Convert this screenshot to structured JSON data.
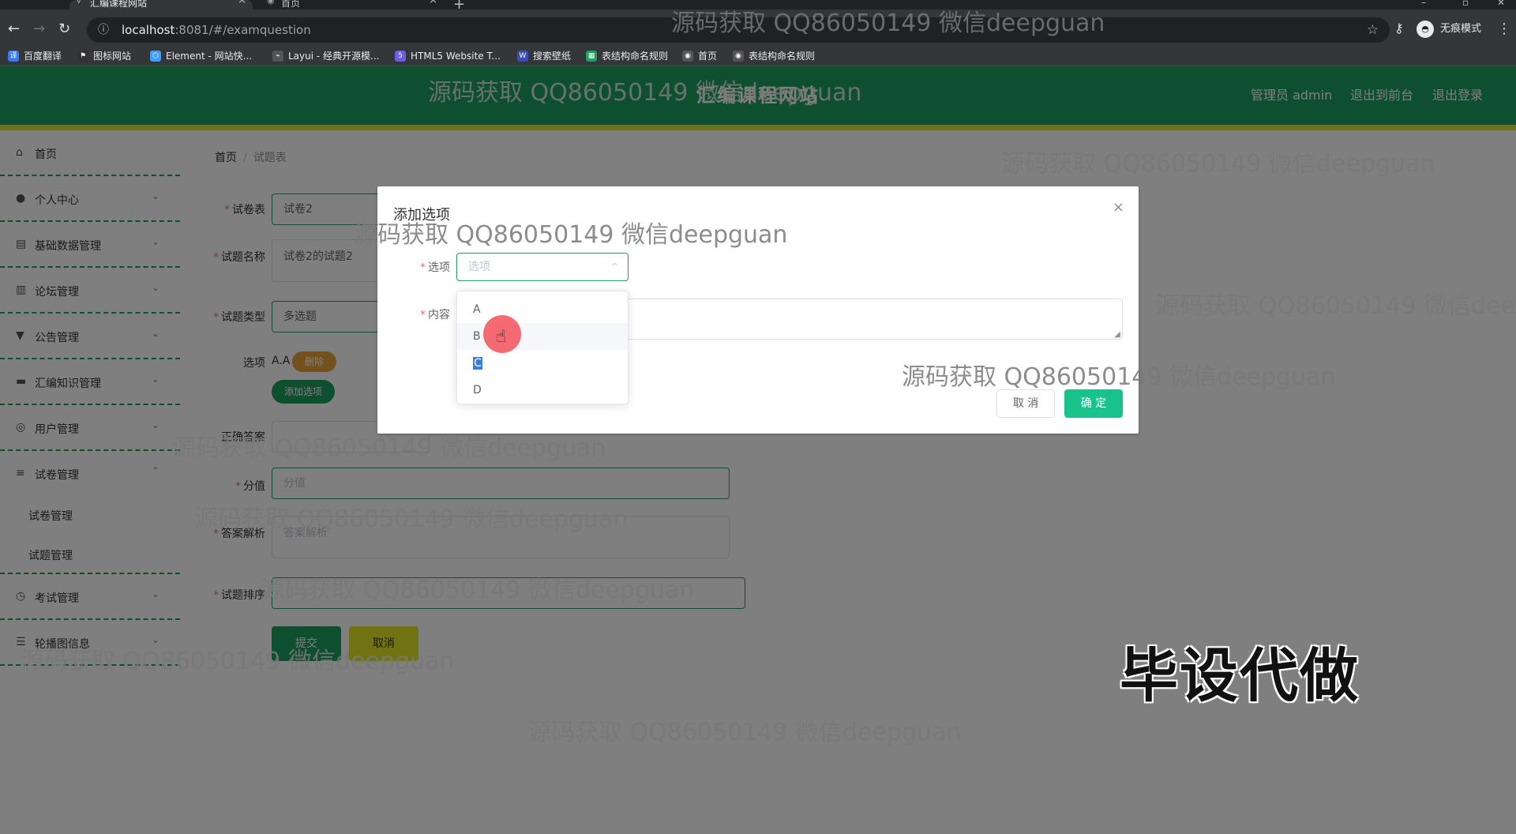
{
  "browser": {
    "tabs": [
      {
        "title": "汇编课程网站",
        "active": true
      },
      {
        "title": "首页",
        "active": false
      }
    ],
    "url_host": "localhost",
    "url_path": ":8081/#/examquestion",
    "profile_label": "无痕模式",
    "bookmarks": [
      "百度翻译",
      "图标网站",
      "Element - 网站快...",
      "Layui - 经典开源模...",
      "HTML5 Website T...",
      "搜索壁纸",
      "表结构命名规则",
      "首页",
      "表结构命名规则"
    ]
  },
  "header": {
    "site_title": "汇编课程网站",
    "user_label": "管理员 admin",
    "back_link": "退出到前台",
    "logout_link": "退出登录"
  },
  "sidebar": {
    "items": [
      {
        "label": "首页",
        "icon": "home-icon"
      },
      {
        "label": "个人中心",
        "icon": "user-icon"
      },
      {
        "label": "基础数据管理",
        "icon": "data-icon"
      },
      {
        "label": "论坛管理",
        "icon": "forum-icon"
      },
      {
        "label": "公告管理",
        "icon": "notice-icon"
      },
      {
        "label": "汇编知识管理",
        "icon": "knowledge-icon"
      },
      {
        "label": "用户管理",
        "icon": "users-icon"
      },
      {
        "label": "试卷管理",
        "icon": "list-icon"
      },
      {
        "label": "考试管理",
        "icon": "exam-icon"
      },
      {
        "label": "轮播图信息",
        "icon": "carousel-icon"
      }
    ],
    "subitems": [
      "试卷管理",
      "试题管理"
    ]
  },
  "breadcrumb": {
    "home": "首页",
    "current": "试题表"
  },
  "form": {
    "paper_label": "试卷表",
    "paper_value": "试卷2",
    "name_label": "试题名称",
    "name_value": "试卷2的试题2",
    "type_label": "试题类型",
    "type_value": "多选题",
    "options_label": "选项",
    "option_tag": "A.A",
    "delete_label": "删除",
    "add_option_label": "添加选项",
    "answer_label": "正确答案",
    "score_label": "分值",
    "score_placeholder": "分值",
    "analysis_label": "答案解析",
    "analysis_placeholder": "答案解析",
    "sort_label": "试题排序",
    "submit_label": "提交",
    "cancel_label": "取消"
  },
  "dialog": {
    "title": "添加选项",
    "option_label": "选项",
    "option_placeholder": "选项",
    "content_label": "内容",
    "cancel_label": "取 消",
    "ok_label": "确 定",
    "dropdown_options": [
      "A",
      "B",
      "C",
      "D"
    ]
  },
  "watermark": {
    "text": "源码获取 QQ86050149 微信deepguan",
    "stamp": "毕设代做"
  }
}
